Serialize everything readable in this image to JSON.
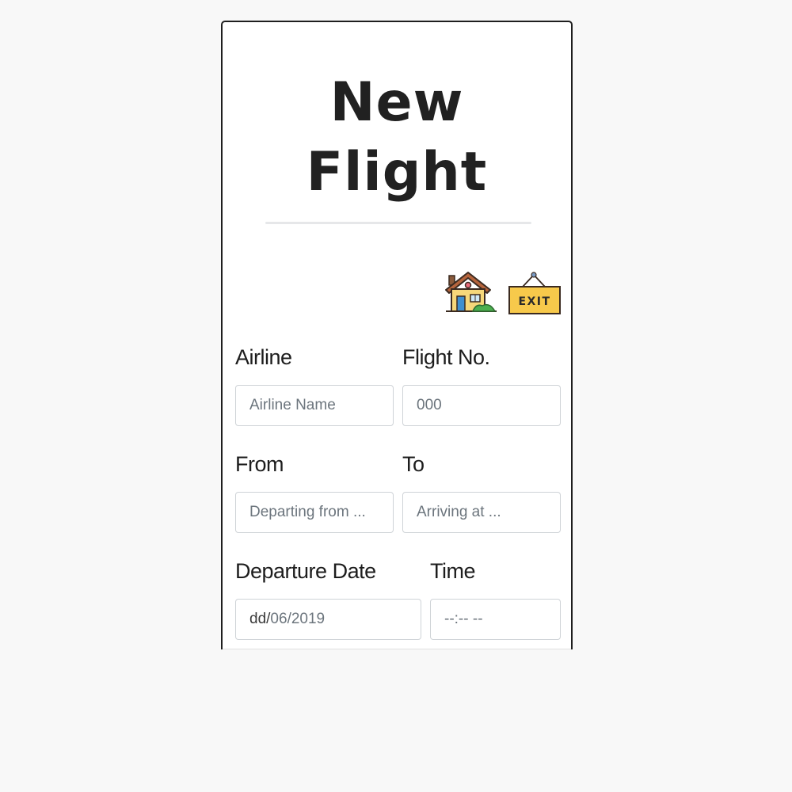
{
  "page": {
    "title_line1": "New",
    "title_line2": "Flight"
  },
  "nav": {
    "home_icon": "house-icon",
    "exit_icon": "exit-sign-icon",
    "exit_label": "EXIT"
  },
  "form": {
    "airline": {
      "label": "Airline",
      "placeholder": "Airline Name"
    },
    "flight_no": {
      "label": "Flight No.",
      "placeholder": "000"
    },
    "from": {
      "label": "From",
      "placeholder": "Departing from ..."
    },
    "to": {
      "label": "To",
      "placeholder": "Arriving at ..."
    },
    "departure_date": {
      "label": "Departure Date",
      "day": "dd",
      "sep1": "/",
      "month": "06",
      "sep2": "/",
      "year": "2019"
    },
    "time": {
      "label": "Time",
      "value": "--:-- --"
    }
  },
  "colors": {
    "page_background": "#f8f8f8",
    "card_background": "#ffffff",
    "title_text": "#212121",
    "input_border": "#cfd3d7",
    "placeholder_text": "#6c757d",
    "exit_sign": "#f7c94b"
  }
}
